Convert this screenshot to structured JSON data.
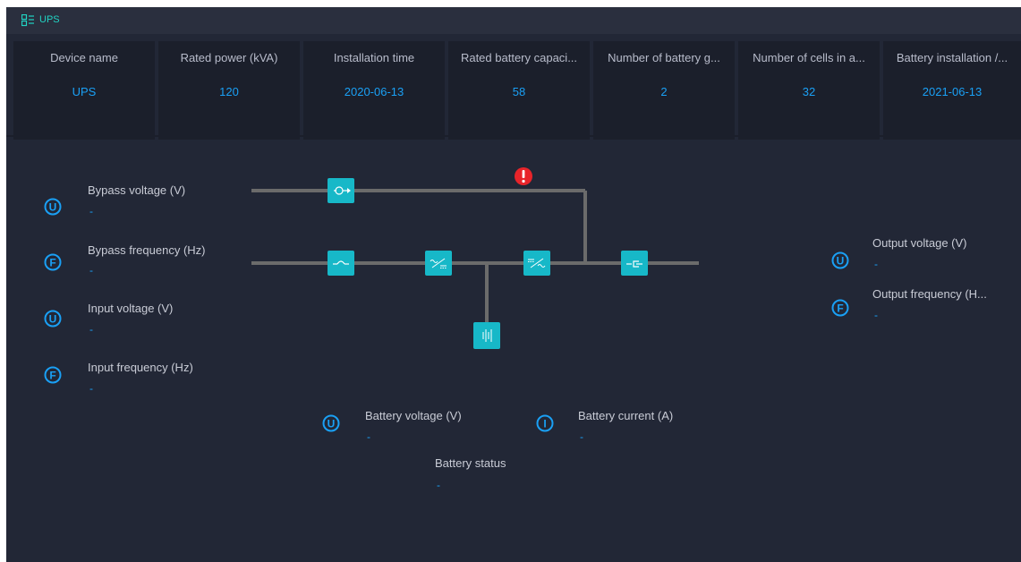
{
  "title": "UPS",
  "info_cards": [
    {
      "label": "Device name",
      "value": "UPS"
    },
    {
      "label": "Rated power (kVA)",
      "value": "120"
    },
    {
      "label": "Installation time",
      "value": "2020-06-13"
    },
    {
      "label": "Rated battery capaci...",
      "value": "58"
    },
    {
      "label": "Number of battery g...",
      "value": "2"
    },
    {
      "label": "Number of cells in a...",
      "value": "32"
    },
    {
      "label": "Battery installation /...",
      "value": "2021-06-13"
    }
  ],
  "metrics": {
    "bypass_voltage": {
      "label": "Bypass voltage (V)",
      "value": "-",
      "icon": "U"
    },
    "bypass_frequency": {
      "label": "Bypass frequency (Hz)",
      "value": "-",
      "icon": "F"
    },
    "input_voltage": {
      "label": "Input voltage (V)",
      "value": "-",
      "icon": "U"
    },
    "input_frequency": {
      "label": "Input frequency (Hz)",
      "value": "-",
      "icon": "F"
    },
    "output_voltage": {
      "label": "Output voltage (V)",
      "value": "-",
      "icon": "U"
    },
    "output_frequency": {
      "label": "Output frequency (H...",
      "value": "-",
      "icon": "F"
    },
    "battery_voltage": {
      "label": "Battery voltage (V)",
      "value": "-",
      "icon": "U"
    },
    "battery_current": {
      "label": "Battery current (A)",
      "value": "-",
      "icon": "I"
    },
    "battery_status": {
      "label": "Battery status",
      "value": "-"
    }
  },
  "colors": {
    "accent": "#21d4c4",
    "value": "#1aa0f5",
    "alarm": "#e8242a",
    "line": "#6b6b6b"
  }
}
